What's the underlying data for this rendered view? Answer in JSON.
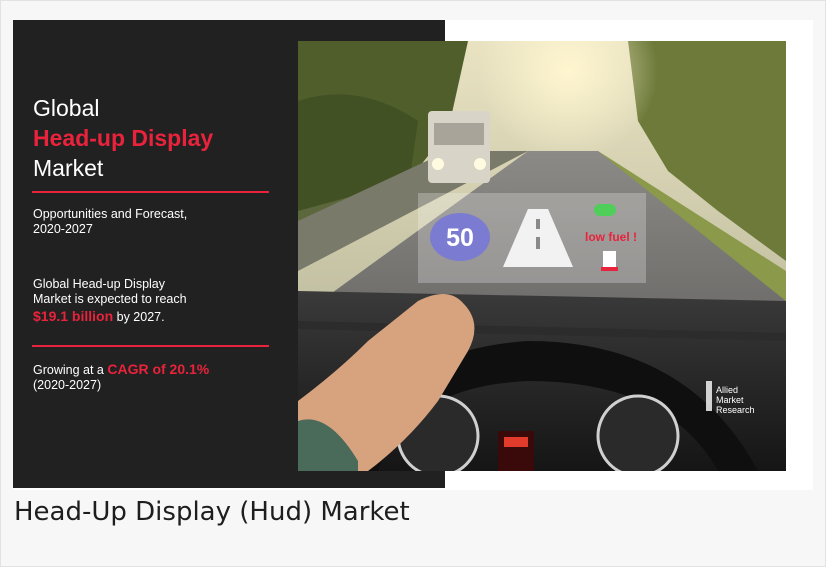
{
  "banner": {
    "title_line1": "Global",
    "title_line2": "Head-up Display",
    "title_line3": "Market",
    "subtitle_line1": "Opportunities and Forecast,",
    "subtitle_line2": "2020-2027",
    "reach_line1": "Global Head-up Display",
    "reach_line2": "Market is expected to reach",
    "reach_value": "$19.1 billion",
    "reach_suffix": " by 2027.",
    "cagr_prefix": "Growing at a ",
    "cagr_value": "CAGR of 20.1%",
    "cagr_period": "(2020-2027)"
  },
  "hud": {
    "speed": "50",
    "warning": "low fuel !"
  },
  "brand": {
    "line1": "Allied",
    "line2": "Market",
    "line3": "Research"
  },
  "caption": "Head-Up Display (Hud) Market",
  "colors": {
    "accent": "#e8233b",
    "panel": "#212121"
  }
}
